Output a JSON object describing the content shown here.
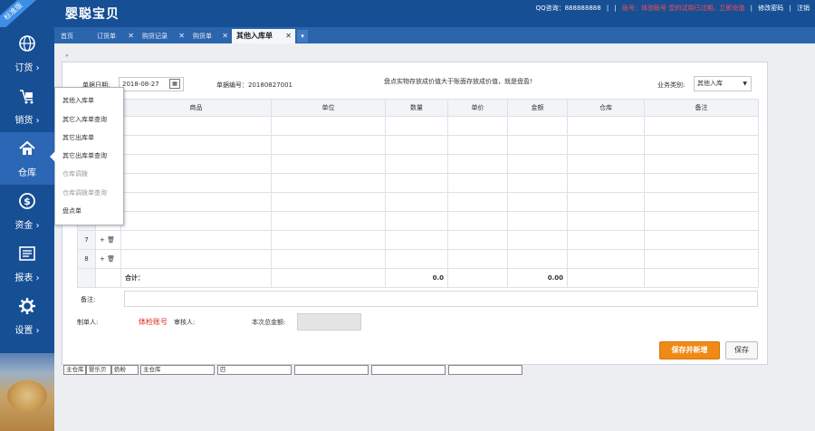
{
  "header": {
    "brand": "婴聪宝贝",
    "ribbon": "标准版",
    "qq_label": "QQ咨询：888888888",
    "sep": "|",
    "account_notice": "账号：体验账号  您的试用已过期，立即充值",
    "change_password": "修改密码",
    "logout": "注销"
  },
  "sidebar": {
    "items": [
      {
        "label": "订货",
        "chevron": "›",
        "icon": "globe-icon"
      },
      {
        "label": "销货",
        "chevron": "›",
        "icon": "cart-icon"
      },
      {
        "label": "仓库",
        "chevron": "",
        "icon": "home-icon"
      },
      {
        "label": "资金",
        "chevron": "›",
        "icon": "coin-icon"
      },
      {
        "label": "报表",
        "chevron": "›",
        "icon": "report-icon"
      },
      {
        "label": "设置",
        "chevron": "›",
        "icon": "gear-icon"
      }
    ]
  },
  "tabs": {
    "items": [
      {
        "label": "首页",
        "close": ""
      },
      {
        "label": "订货单",
        "close": "✕"
      },
      {
        "label": "购货记录",
        "close": "✕"
      },
      {
        "label": "购货单",
        "close": "✕"
      },
      {
        "label": "其他入库单",
        "close": "✕"
      }
    ],
    "more": "▾"
  },
  "scroll_indicator": "»",
  "form": {
    "date_label": "单据日期:",
    "date_value": "2018-08-27",
    "doc_no_label": "单据编号：",
    "doc_no_value": "20180827001",
    "hint": "盘点实物存放成价值大于账面存放成价值，就是盘盈!",
    "biz_type_label": "业务类别:",
    "biz_type_value": "其他入库",
    "remark_label": "备注:",
    "maker_label": "制单人:",
    "maker_value": "体检账号",
    "reviewer_label": "审核人:",
    "amount_label": "本次总金额:"
  },
  "table": {
    "headers": [
      "",
      "",
      "商品",
      "单位",
      "数量",
      "单价",
      "金额",
      "仓库",
      "备注"
    ],
    "visible_rows": [
      {
        "no": "7",
        "ops": "+ ",
        "del": "🗑"
      },
      {
        "no": "8",
        "ops": "+ ",
        "del": "🗑"
      }
    ],
    "total_label": "合计：",
    "total_qty": "0.0",
    "total_amount": "0.00"
  },
  "buttons": {
    "save_new": "保存并新增",
    "save": "保存"
  },
  "submenu": {
    "items": [
      {
        "label": "其他入库单",
        "dim": false
      },
      {
        "label": "其它入库单查询",
        "dim": false
      },
      {
        "label": "其它出库单",
        "dim": false
      },
      {
        "label": "其它出库单查询",
        "dim": false
      },
      {
        "label": "仓库调拨",
        "dim": true
      },
      {
        "label": "仓库调拨单查询",
        "dim": true
      },
      {
        "label": "盘点单",
        "dim": false
      }
    ]
  },
  "stray_fields": [
    "主仓库",
    "婴乐贝",
    "奶粉",
    "主仓库",
    "匹",
    "",
    "",
    ""
  ]
}
